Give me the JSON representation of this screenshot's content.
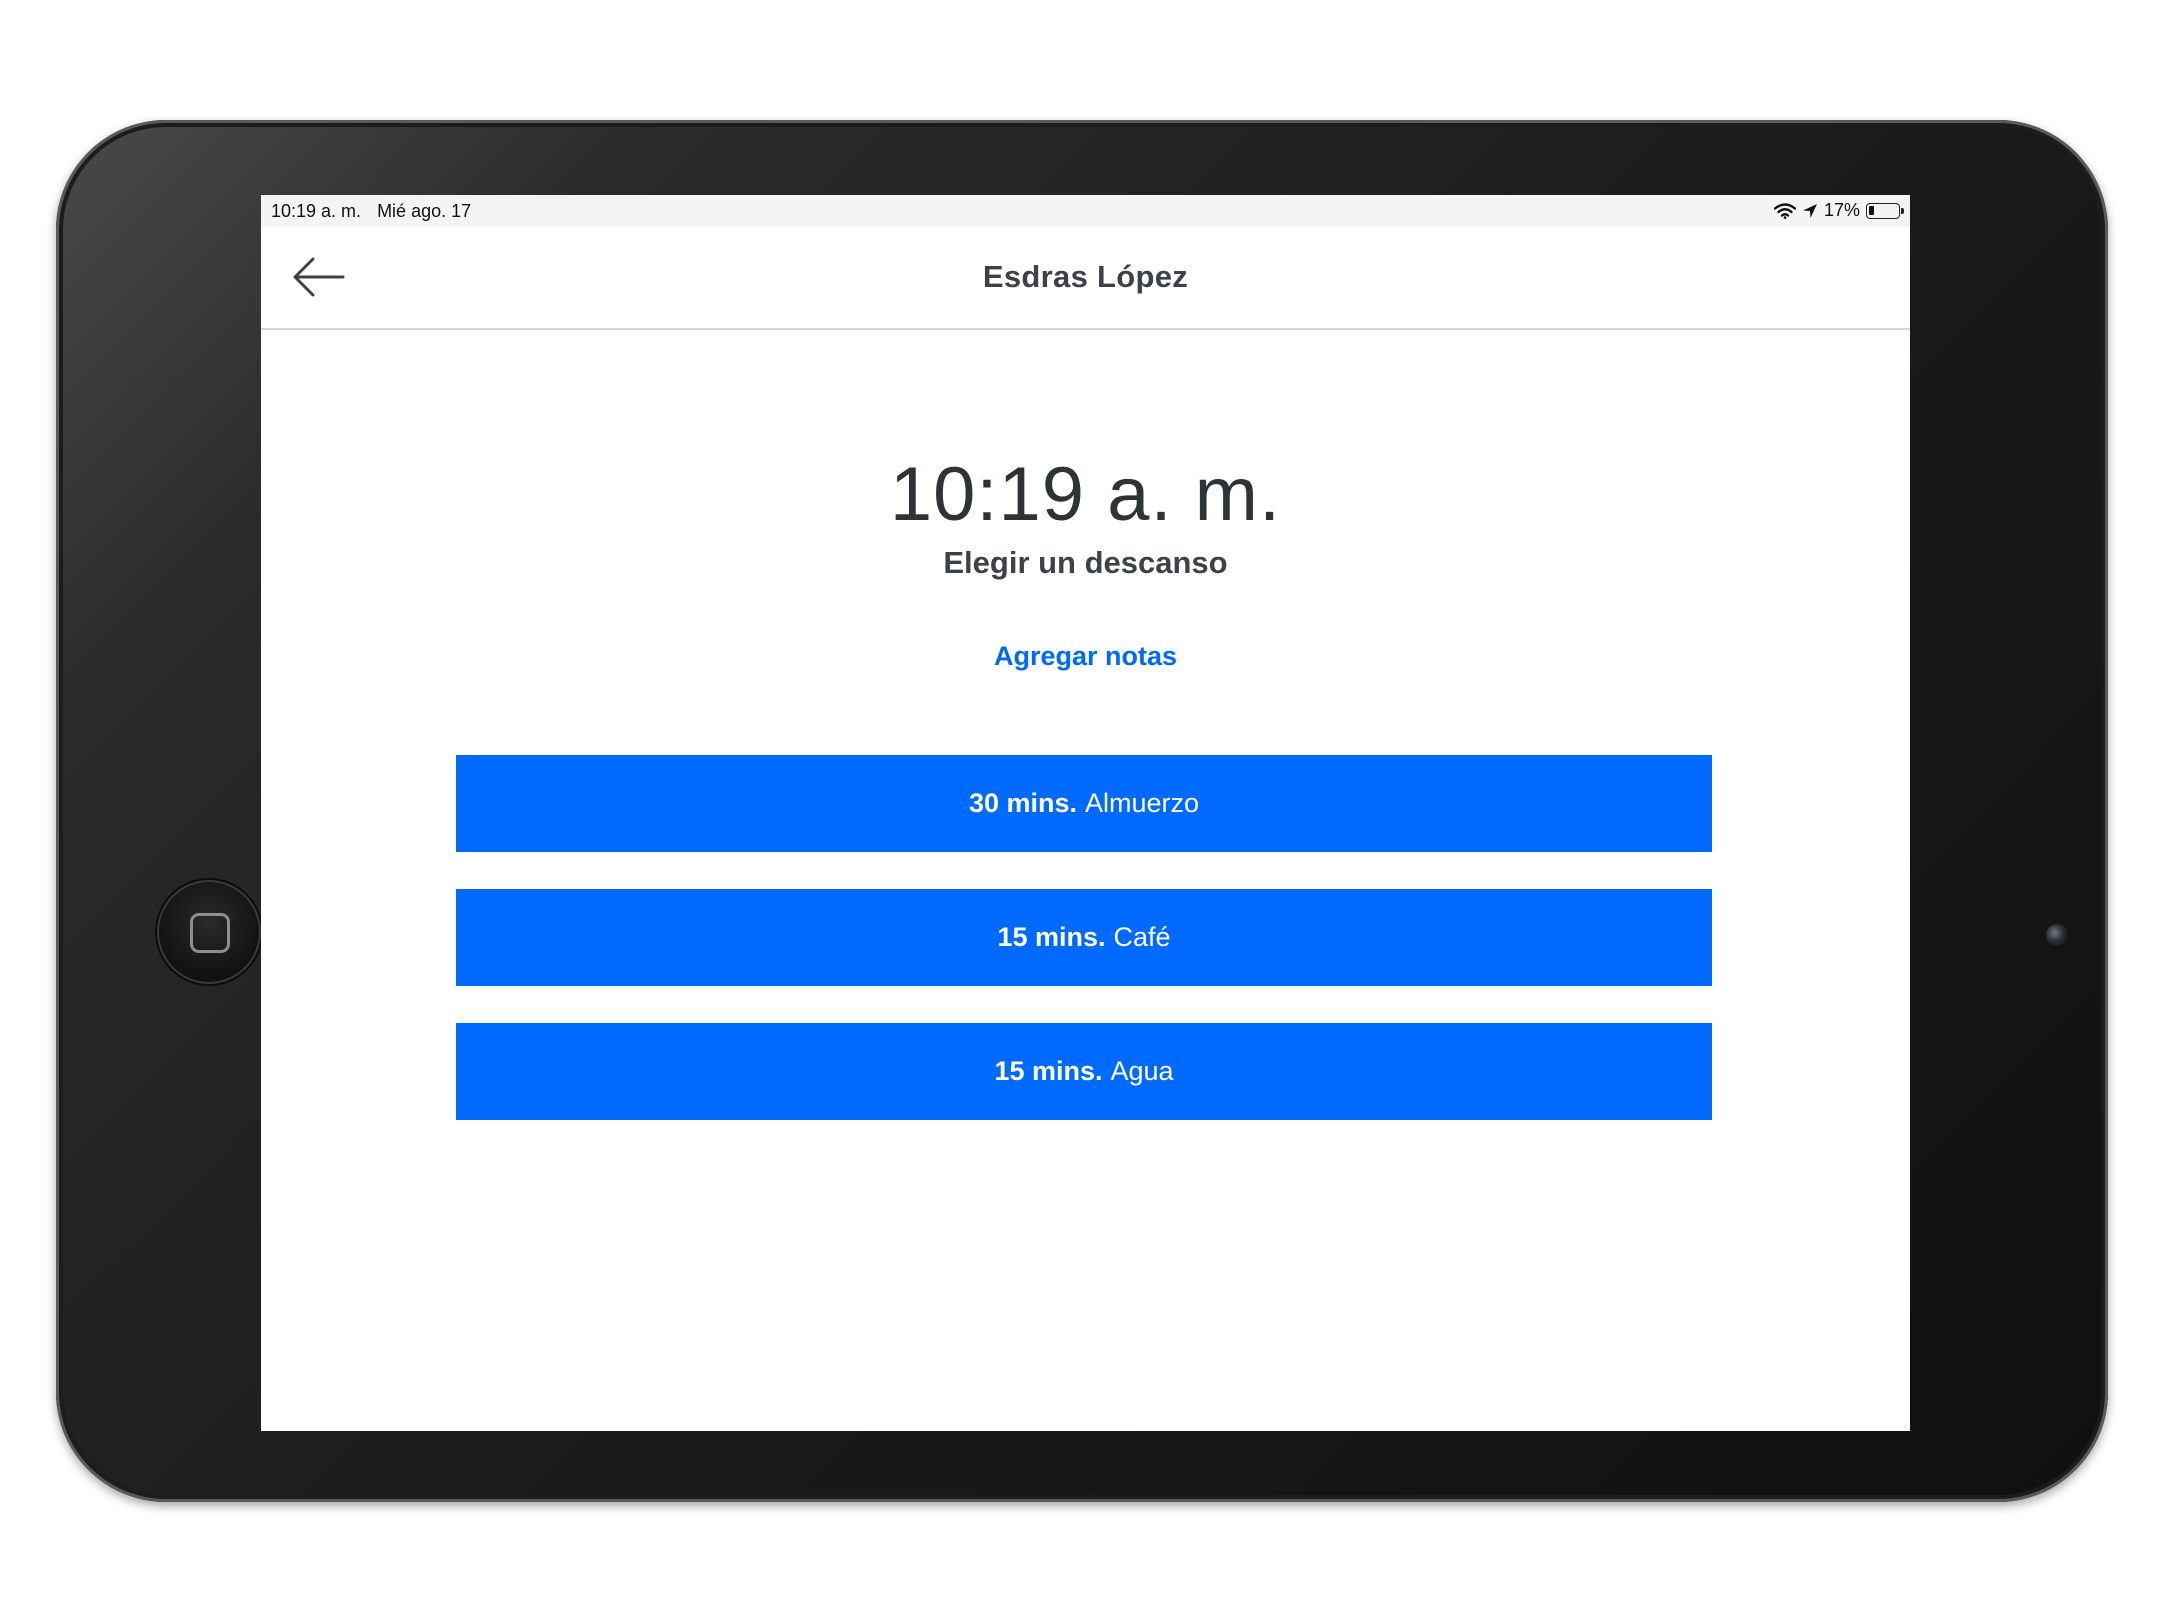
{
  "status_bar": {
    "time": "10:19 a. m.",
    "date": "Mié ago. 17",
    "battery": "17%",
    "battery_level": 0.17,
    "icons": [
      "wifi-icon",
      "location-arrow-icon",
      "battery-icon"
    ]
  },
  "header": {
    "title": "Esdras López",
    "back_icon": "arrow-left-icon"
  },
  "main": {
    "clock": "10:19 a. m.",
    "subtitle": "Elegir un descanso",
    "add_notes_label": "Agregar notas",
    "breaks": [
      {
        "duration": "30 mins.",
        "name": "Almuerzo"
      },
      {
        "duration": "15 mins.",
        "name": "Café"
      },
      {
        "duration": "15 mins.",
        "name": "Agua"
      }
    ]
  },
  "colors": {
    "accent": "#006aff",
    "text_dark": "#3c4248",
    "status_bar_bg": "#f4f4f5",
    "divider": "#d5d7da"
  }
}
